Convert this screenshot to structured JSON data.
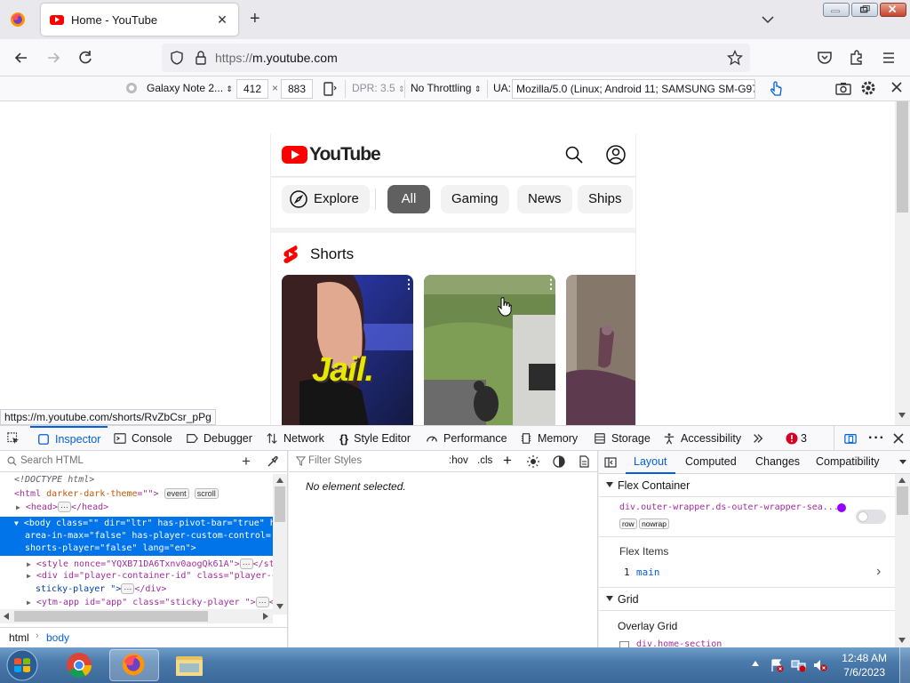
{
  "browser": {
    "tab_title": "Home - YouTube",
    "url_protocol": "https://",
    "url_host": "m.youtube.com",
    "status_link": "https://m.youtube.com/shorts/RvZbCsr_pPg"
  },
  "rdm": {
    "device": "Galaxy Note 2...",
    "width": "412",
    "times": "×",
    "height": "883",
    "dpr": "DPR: 3.5",
    "throttling": "No Throttling",
    "ua_label": "UA:",
    "ua_value": "Mozilla/5.0 (Linux; Android 11; SAMSUNG SM-G97..."
  },
  "youtube": {
    "logo_text": "YouTube",
    "chips": [
      {
        "label": "Explore"
      },
      {
        "label": "All"
      },
      {
        "label": "Gaming"
      },
      {
        "label": "News"
      },
      {
        "label": "Ships"
      }
    ],
    "shorts_title": "Shorts",
    "short_overlay_text": "Jail."
  },
  "devtools": {
    "tabs": [
      "Inspector",
      "Console",
      "Debugger",
      "Network",
      "Style Editor",
      "Performance",
      "Memory",
      "Storage",
      "Accessibility"
    ],
    "error_count": "3",
    "search_html_placeholder": "Search HTML",
    "filter_styles_placeholder": "Filter Styles",
    "hov": ":hov",
    "cls": ".cls",
    "no_element": "No element selected.",
    "breadcrumbs": [
      "html",
      "body"
    ],
    "markup": {
      "doctype": "<!DOCTYPE html>",
      "html_open": "<html",
      "html_attr_name": "darker-dark-theme",
      "html_attr_val": "=\"\">",
      "badge_event": "event",
      "badge_scroll": "scroll",
      "head_open": "<head>",
      "head_close": "</head>",
      "body_line1": "<body class=\"\" dir=\"ltr\" has-pivot-bar=\"true\" h",
      "body_line2": "area-in-max=\"false\" has-player-custom-control=",
      "body_line3": "shorts-player=\"false\" lang=\"en\">",
      "style_line": "<style nonce=\"YQXB71DA6Txnv0aogQk61A\">",
      "style_close": "</st",
      "div_line1": "<div id=\"player-container-id\" class=\"player-c",
      "div_line2": "sticky-player \">",
      "div_close": "</div>",
      "ytm_line": "<ytm-app id=\"app\" class=\"sticky-player \">",
      "ytm_close": "<"
    },
    "layout_tabs": [
      "Layout",
      "Computed",
      "Changes",
      "Compatibility"
    ],
    "flex_container_label": "Flex Container",
    "flex_selector": "div.outer-wrapper.ds-outer-wrapper-sea...",
    "flex_badges": [
      "row",
      "nowrap"
    ],
    "flex_items_label": "Flex Items",
    "flex_item_index": "1",
    "flex_item_name": "main",
    "grid_label": "Grid",
    "overlay_grid_label": "Overlay Grid",
    "grid_item_partial": "div.home-section"
  },
  "taskbar": {
    "time": "12:48 AM",
    "date": "7/6/2023"
  },
  "colors": {
    "accent": "#0060df",
    "yt_red": "#ff0000",
    "selection": "#0074e8"
  }
}
